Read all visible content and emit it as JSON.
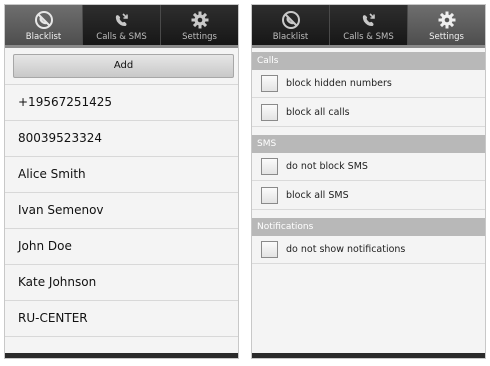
{
  "tabs": [
    {
      "label": "Blacklist",
      "icon": "blocked-phone-icon"
    },
    {
      "label": "Calls & SMS",
      "icon": "call-log-icon"
    },
    {
      "label": "Settings",
      "icon": "gear-icon"
    }
  ],
  "left": {
    "active_tab": "Blacklist",
    "add_label": "Add",
    "contacts": [
      "+19567251425",
      "80039523324",
      "Alice Smith",
      "Ivan Semenov",
      "John Doe",
      "Kate Johnson",
      "RU-CENTER"
    ]
  },
  "right": {
    "active_tab": "Settings",
    "sections": [
      {
        "title": "Calls",
        "options": [
          {
            "label": "block hidden numbers",
            "checked": false
          },
          {
            "label": "block all calls",
            "checked": false
          }
        ]
      },
      {
        "title": "SMS",
        "options": [
          {
            "label": "do not block SMS",
            "checked": false
          },
          {
            "label": "block all SMS",
            "checked": false
          }
        ]
      },
      {
        "title": "Notifications",
        "options": [
          {
            "label": "do not show notifications",
            "checked": false
          }
        ]
      }
    ]
  }
}
